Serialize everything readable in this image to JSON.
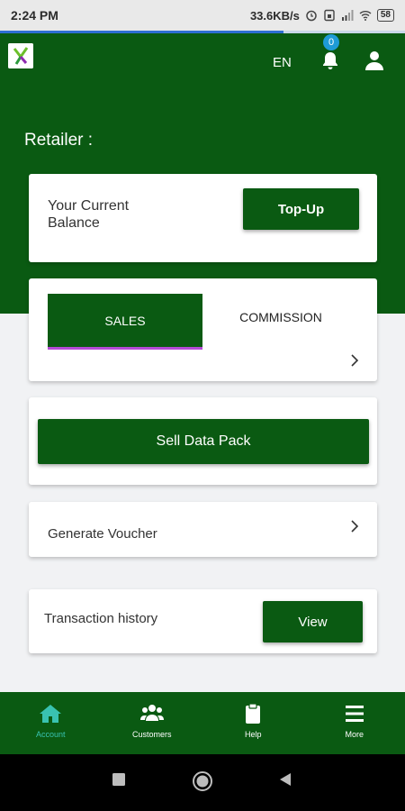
{
  "status_bar": {
    "time": "2:24 PM",
    "net_speed": "33.6KB/s",
    "battery": "58"
  },
  "header": {
    "language": "EN",
    "notification_count": "0"
  },
  "greeting": "Retailer :",
  "balance_card": {
    "label": "Your Current Balance",
    "topup_label": "Top-Up"
  },
  "tabs": {
    "sales_label": "SALES",
    "commission_label": "COMMISSION"
  },
  "sell_data_pack_label": "Sell Data Pack",
  "generate_voucher_label": "Generate Voucher",
  "transaction_history": {
    "label": "Transaction history",
    "view_label": "View"
  },
  "bottom_nav": {
    "items": [
      {
        "label": "Account",
        "icon": "home-icon",
        "active": true
      },
      {
        "label": "Customers",
        "icon": "people-icon",
        "active": false
      },
      {
        "label": "Help",
        "icon": "clipboard-icon",
        "active": false
      },
      {
        "label": "More",
        "icon": "menu-icon",
        "active": false
      }
    ]
  },
  "colors": {
    "brand_green": "#0a5a12",
    "active_nav": "#39c2b0",
    "badge_blue": "#1e9bd6",
    "tab_underline": "#b44ad6"
  }
}
